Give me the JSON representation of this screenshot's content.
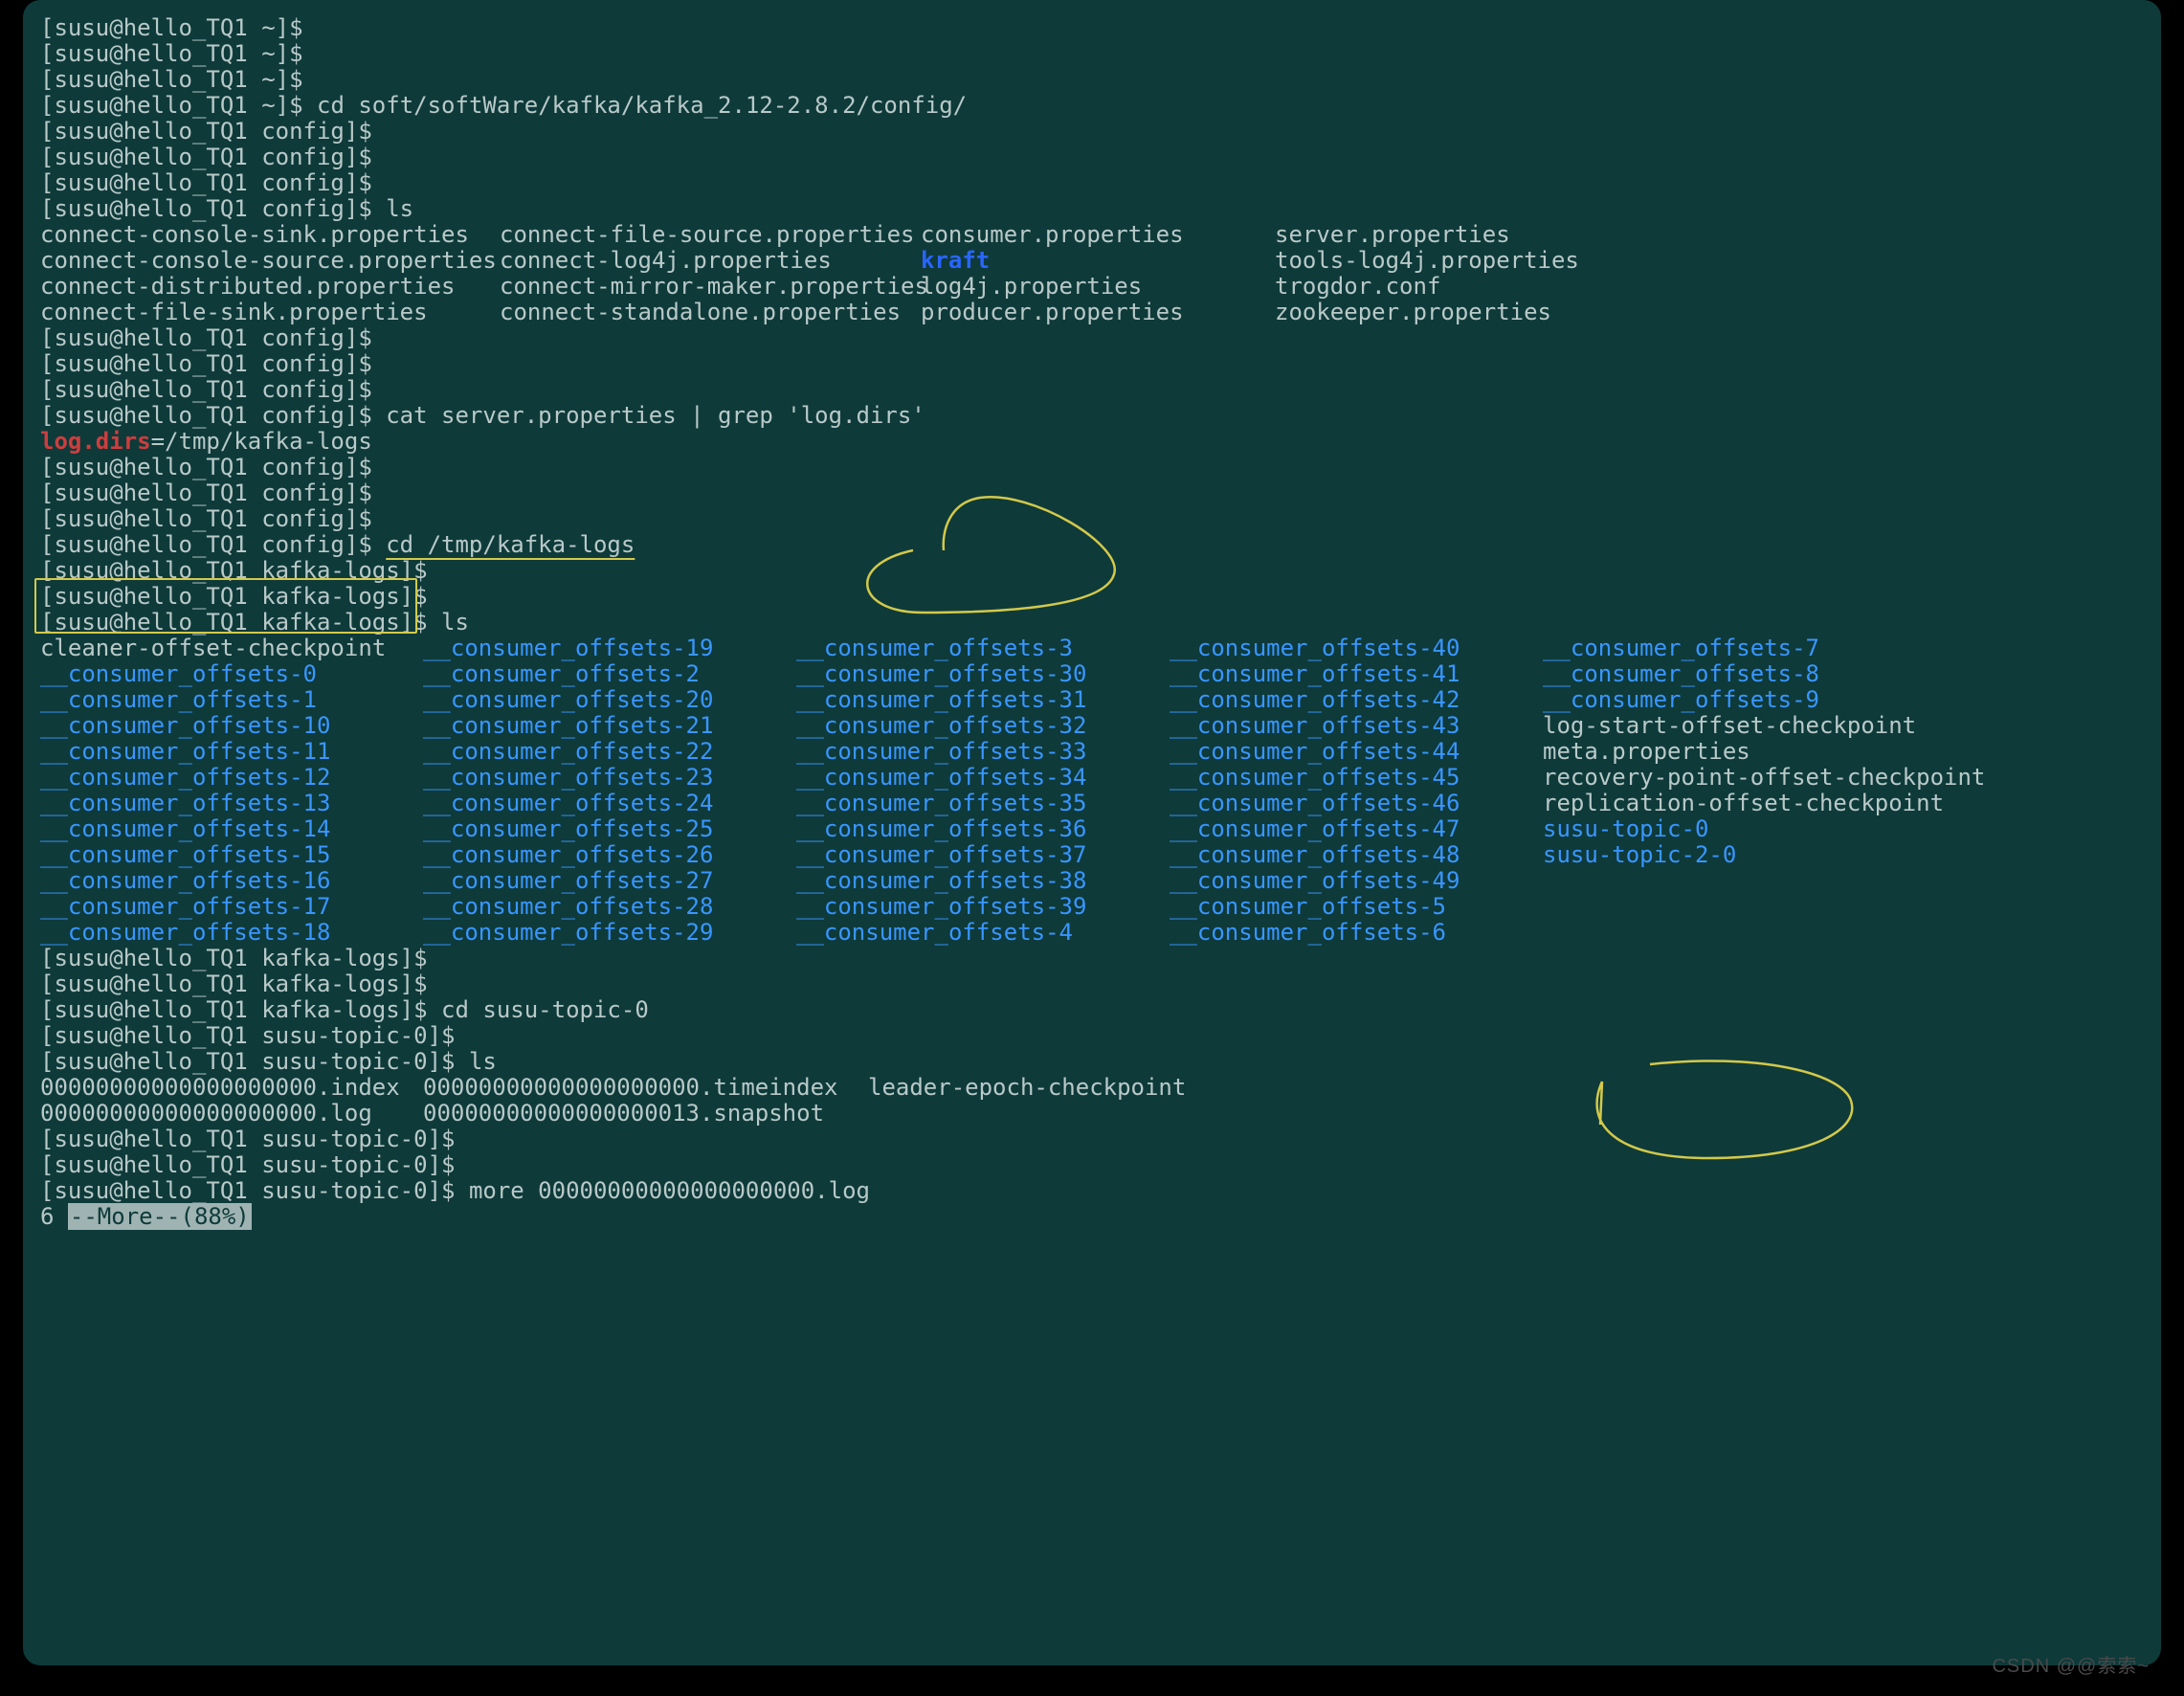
{
  "watermark": "CSDN @@索索~",
  "user": "susu",
  "host": "hello_TQ1",
  "paths": {
    "home": "~",
    "config": "config",
    "kafkalogs": "kafka-logs",
    "topic": "susu-topic-0"
  },
  "commands": {
    "cd_config": "cd soft/softWare/kafka/kafka_2.12-2.8.2/config/",
    "ls": "ls",
    "grep": "cat server.properties | grep 'log.dirs'",
    "grep_match": "log.dirs",
    "grep_rest": "=/tmp/kafka-logs",
    "cd_logs": "cd /tmp/kafka-logs",
    "cd_topic": "cd susu-topic-0",
    "more": "more 00000000000000000000.log"
  },
  "config_rows": [
    [
      "connect-console-sink.properties",
      "connect-file-source.properties",
      "consumer.properties",
      "server.properties"
    ],
    [
      "connect-console-source.properties",
      "connect-log4j.properties",
      "kraft",
      "tools-log4j.properties"
    ],
    [
      "connect-distributed.properties",
      "connect-mirror-maker.properties",
      "log4j.properties",
      "trogdor.conf"
    ],
    [
      "connect-file-sink.properties",
      "connect-standalone.properties",
      "producer.properties",
      "zookeeper.properties"
    ]
  ],
  "config_row_dir_index": {
    "1": 2
  },
  "logs_rows": [
    [
      "cleaner-offset-checkpoint",
      "__consumer_offsets-19",
      "__consumer_offsets-3",
      "__consumer_offsets-40",
      "__consumer_offsets-7"
    ],
    [
      "__consumer_offsets-0",
      "__consumer_offsets-2",
      "__consumer_offsets-30",
      "__consumer_offsets-41",
      "__consumer_offsets-8"
    ],
    [
      "__consumer_offsets-1",
      "__consumer_offsets-20",
      "__consumer_offsets-31",
      "__consumer_offsets-42",
      "__consumer_offsets-9"
    ],
    [
      "__consumer_offsets-10",
      "__consumer_offsets-21",
      "__consumer_offsets-32",
      "__consumer_offsets-43",
      "log-start-offset-checkpoint"
    ],
    [
      "__consumer_offsets-11",
      "__consumer_offsets-22",
      "__consumer_offsets-33",
      "__consumer_offsets-44",
      "meta.properties"
    ],
    [
      "__consumer_offsets-12",
      "__consumer_offsets-23",
      "__consumer_offsets-34",
      "__consumer_offsets-45",
      "recovery-point-offset-checkpoint"
    ],
    [
      "__consumer_offsets-13",
      "__consumer_offsets-24",
      "__consumer_offsets-35",
      "__consumer_offsets-46",
      "replication-offset-checkpoint"
    ],
    [
      "__consumer_offsets-14",
      "__consumer_offsets-25",
      "__consumer_offsets-36",
      "__consumer_offsets-47",
      "susu-topic-0"
    ],
    [
      "__consumer_offsets-15",
      "__consumer_offsets-26",
      "__consumer_offsets-37",
      "__consumer_offsets-48",
      "susu-topic-2-0"
    ],
    [
      "__consumer_offsets-16",
      "__consumer_offsets-27",
      "__consumer_offsets-38",
      "__consumer_offsets-49",
      ""
    ],
    [
      "__consumer_offsets-17",
      "__consumer_offsets-28",
      "__consumer_offsets-39",
      "__consumer_offsets-5",
      ""
    ],
    [
      "__consumer_offsets-18",
      "__consumer_offsets-29",
      "__consumer_offsets-4",
      "__consumer_offsets-6",
      ""
    ]
  ],
  "logs_nondir_cells": [
    [
      0,
      0
    ],
    [
      3,
      4
    ],
    [
      4,
      4
    ],
    [
      5,
      4
    ],
    [
      6,
      4
    ]
  ],
  "topic_rows": [
    [
      "00000000000000000000.index",
      "00000000000000000000.timeindex",
      "leader-epoch-checkpoint"
    ],
    [
      "00000000000000000000.log",
      "00000000000000000013.snapshot",
      ""
    ]
  ],
  "more_output": {
    "col0": "6 ",
    "tag": "--More--(88%)"
  }
}
